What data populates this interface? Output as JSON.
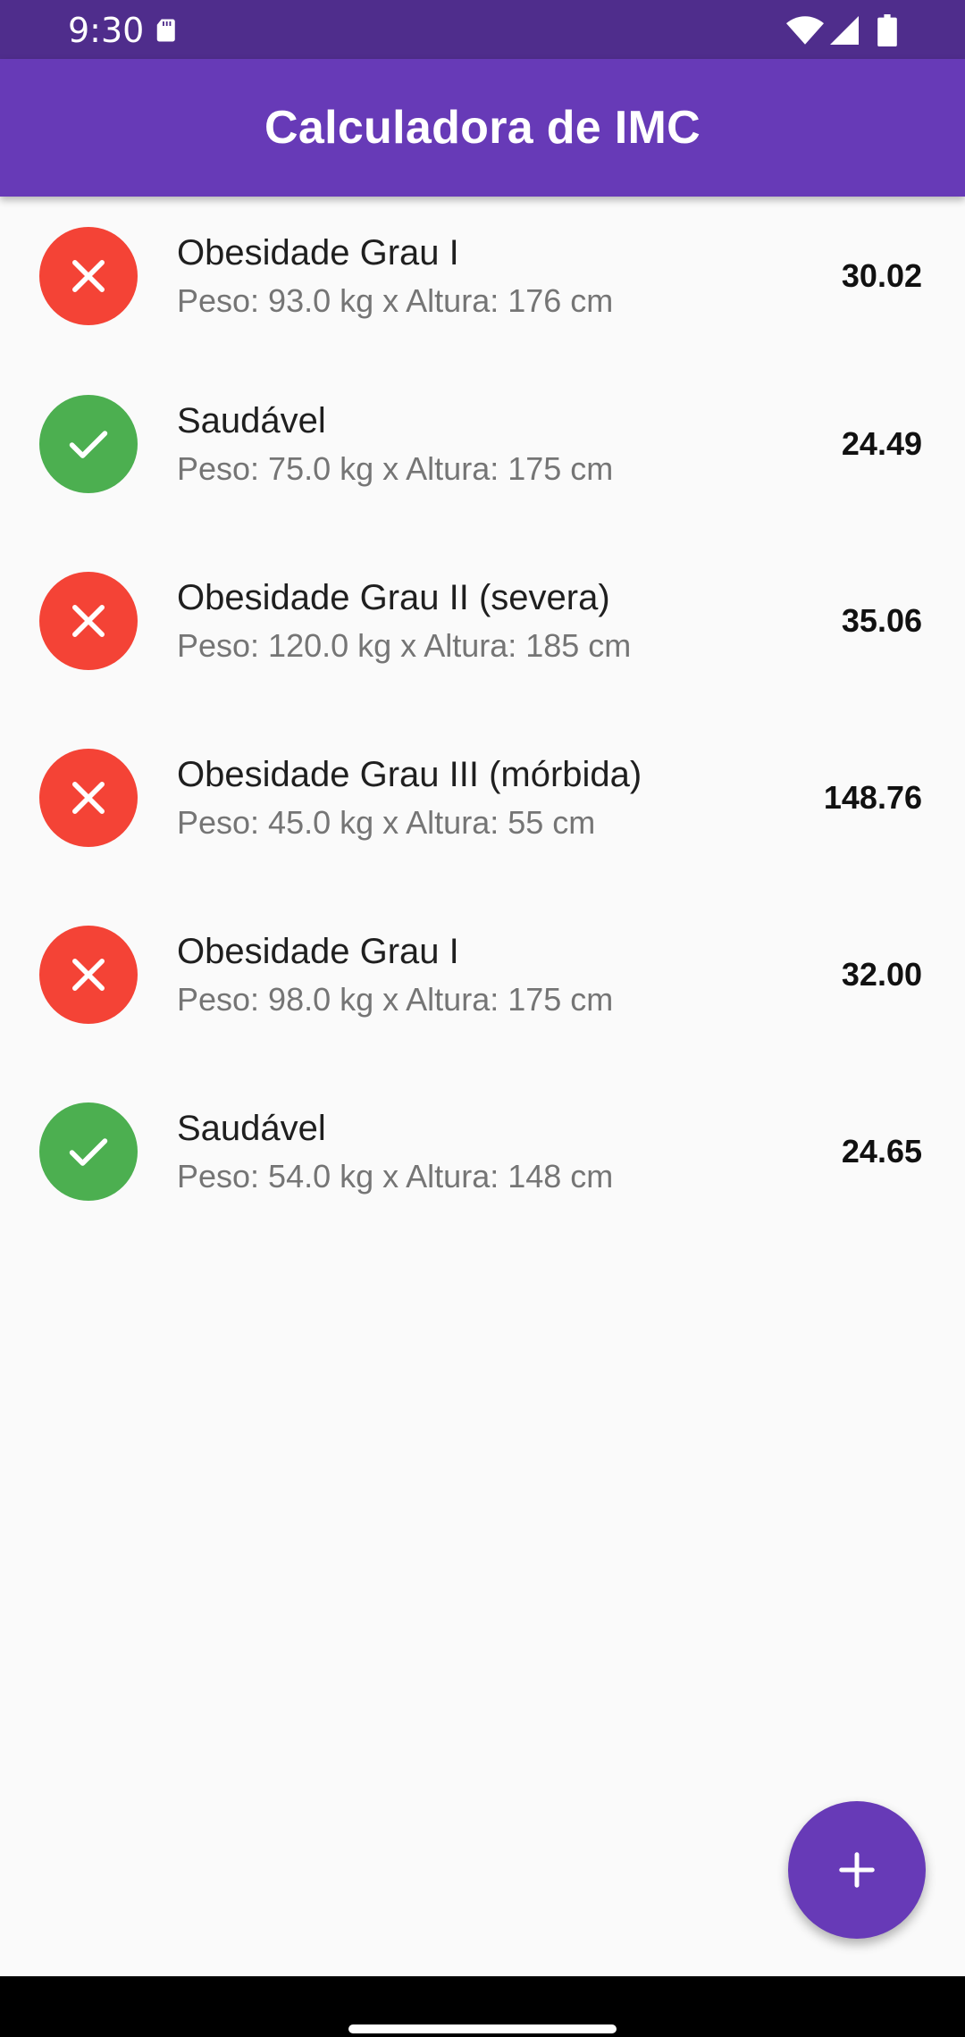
{
  "status_bar": {
    "time": "9:30",
    "icons": [
      "sd-card-icon",
      "wifi-icon",
      "signal-icon",
      "battery-icon"
    ]
  },
  "app_bar": {
    "title": "Calculadora de IMC",
    "color": "#673ab7"
  },
  "records": [
    {
      "status": "bad",
      "icon": "close-icon",
      "title": "Obesidade Grau I",
      "details": "Peso: 93.0 kg x Altura: 176 cm",
      "imc": "30.02"
    },
    {
      "status": "good",
      "icon": "check-icon",
      "title": "Saudável",
      "details": "Peso: 75.0 kg x Altura: 175 cm",
      "imc": "24.49"
    },
    {
      "status": "bad",
      "icon": "close-icon",
      "title": "Obesidade Grau II (severa)",
      "details": "Peso: 120.0 kg x Altura: 185 cm",
      "imc": "35.06"
    },
    {
      "status": "bad",
      "icon": "close-icon",
      "title": "Obesidade Grau III (mórbida)",
      "details": "Peso: 45.0 kg x Altura: 55 cm",
      "imc": "148.76"
    },
    {
      "status": "bad",
      "icon": "close-icon",
      "title": "Obesidade Grau I",
      "details": "Peso: 98.0 kg x Altura: 175 cm",
      "imc": "32.00"
    },
    {
      "status": "good",
      "icon": "check-icon",
      "title": "Saudável",
      "details": "Peso: 54.0 kg x Altura: 148 cm",
      "imc": "24.65"
    }
  ],
  "colors": {
    "bad": "#f44336",
    "good": "#4caf50",
    "fab": "#673ab7"
  },
  "fab": {
    "icon": "plus-icon"
  }
}
